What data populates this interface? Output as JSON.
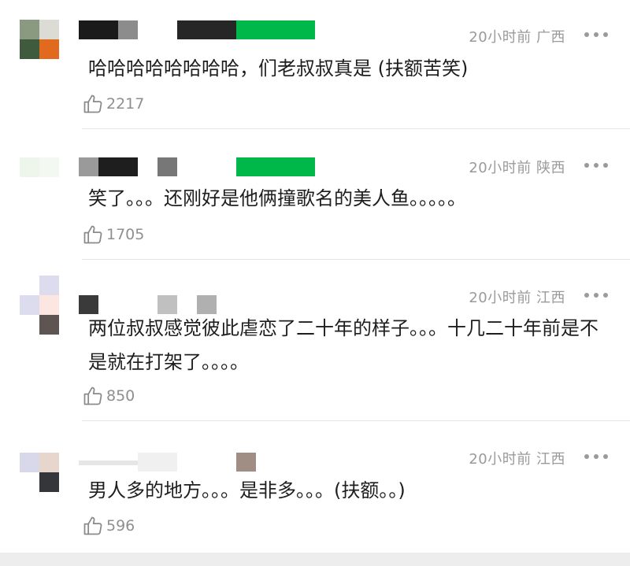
{
  "comments": [
    {
      "avatar_colors": [
        "#8a9a80",
        "#dcdcd4",
        "#3f5a3c",
        "#e26a1f"
      ],
      "name_colors": [
        "#1a1a1a",
        "#8c8c8c",
        "#262626",
        "#00b84a"
      ],
      "meta": "20小时前 广西",
      "text": "哈哈哈哈哈哈哈哈，们老叔叔真是 (扶额苦笑)",
      "likes": "2217"
    },
    {
      "avatar_colors": [
        "#eef6ec",
        "#f4f8f2",
        "#ffffff",
        "#ffffff"
      ],
      "name_colors": [
        "#9a9a9a",
        "#1e1e1e",
        "#777777",
        "#00b84a"
      ],
      "meta": "20小时前 陕西",
      "text": "笑了。。。还刚好是他俩撞歌名的美人鱼。。。。。",
      "likes": "1705"
    },
    {
      "avatar_colors": [
        "#dcdcee",
        "#fce6e2",
        "#ffffff",
        "#5e5452"
      ],
      "name_colors": [
        "#3a3a3a",
        "#c0c0c0",
        "#b0b0b0"
      ],
      "meta": "20小时前 江西",
      "text": "两位叔叔感觉彼此虐恋了二十年的样子。。。十几二十年前是不是就在打架了。。。。",
      "likes": "850"
    },
    {
      "avatar_colors": [
        "#d8d8ea",
        "#e6d6cc",
        "#ffffff",
        "#34363a"
      ],
      "name_colors": [
        "#e6e6e6",
        "#f0f0f0",
        "#a08e84"
      ],
      "meta": "20小时前 江西",
      "text": "男人多的地方。。。是非多。。。(扶额。。)",
      "likes": "596"
    }
  ],
  "icons": {
    "like": "thumbs-up-icon",
    "more": "more-dots-icon"
  },
  "colors": {
    "meta_text": "#9a9a9a",
    "divider": "#e6e6e6",
    "footer_bar": "#ededed"
  }
}
